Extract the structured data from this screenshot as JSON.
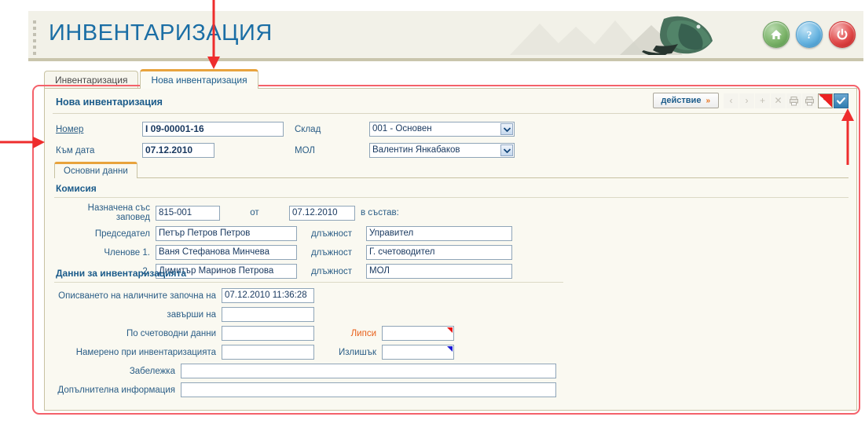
{
  "header": {
    "app_title": "ИНВЕНТАРИЗАЦИЯ",
    "buttons": [
      {
        "name": "home-button",
        "icon": "home-icon",
        "color": "#7cb46a"
      },
      {
        "name": "help-button",
        "icon": "question-icon",
        "color": "#68b4e0"
      },
      {
        "name": "power-button",
        "icon": "power-icon",
        "color": "#e04a4a"
      }
    ]
  },
  "tabs": [
    {
      "label": "Инвентаризация",
      "active": false
    },
    {
      "label": "Нова инвентаризация",
      "active": true
    }
  ],
  "panel": {
    "title": "Нова инвентаризация",
    "toolbar": {
      "action_label": "действие",
      "action_chevron": "»",
      "icons": [
        {
          "name": "prev-record-icon",
          "glyph": "‹",
          "state": "disabled"
        },
        {
          "name": "next-record-icon",
          "glyph": "›",
          "state": "disabled"
        },
        {
          "name": "add-record-icon",
          "glyph": "+",
          "state": "disabled"
        },
        {
          "name": "delete-record-icon",
          "glyph": "✕",
          "state": "disabled"
        },
        {
          "name": "print-icon",
          "glyph": "print",
          "state": "disabled"
        },
        {
          "name": "print-preview-icon",
          "glyph": "print",
          "state": "disabled"
        },
        {
          "name": "cancel-icon",
          "glyph": "redwhite",
          "state": "enabled"
        },
        {
          "name": "confirm-icon",
          "glyph": "✔",
          "state": "enabled"
        }
      ]
    },
    "header_fields": {
      "number_label": "Номер",
      "number_value": "I 09-00001-16",
      "date_label": "Към дата",
      "date_value": "07.12.2010",
      "warehouse_label": "Склад",
      "warehouse_value": "001 - Основен",
      "mol_label": "МОЛ",
      "mol_value": "Валентин Янкабаков"
    },
    "inner_tabs": [
      {
        "label": "Основни данни",
        "active": true
      }
    ],
    "commission": {
      "section_title": "Комисия",
      "order_label": "Назначена със заповед",
      "order_value": "815-001",
      "from_label": "от",
      "from_value": "07.12.2010",
      "composition_label": "в състав:",
      "rows": [
        {
          "label": "Председател",
          "name_value": "Петър Петров Петров",
          "position_label": "длъжност",
          "position_value": "Управител"
        },
        {
          "label": "Членове 1.",
          "name_value": "Ваня Стефанова Минчева",
          "position_label": "длъжност",
          "position_value": "Г. счетоводител"
        },
        {
          "label": "2.",
          "name_value": "Димитър Маринов Петрова",
          "position_label": "длъжност",
          "position_value": "МОЛ"
        }
      ]
    },
    "inventory_data": {
      "section_title": "Данни за инвентаризацията",
      "started_label": "Описването на наличните започна на",
      "started_value": "07.12.2010 11:36:28",
      "finished_label": "завърши на",
      "finished_value": "",
      "accounting_label": "По счетоводни данни",
      "accounting_value": "",
      "shortage_label": "Липси",
      "shortage_value": "",
      "found_label": "Намерено при инвентаризацията",
      "found_value": "",
      "surplus_label": "Излишък",
      "surplus_value": "",
      "note_label": "Забележка",
      "note_value": "",
      "extra_label": "Допълнителна информация",
      "extra_value": ""
    }
  },
  "colors": {
    "accent_blue": "#1b6ea5",
    "label_blue": "#2a5d86",
    "tab_orange": "#e8a33d",
    "annotation_red": "#f4616a",
    "shortage_orange": "#e8601a",
    "surplus_blue": "#2a5d86"
  }
}
